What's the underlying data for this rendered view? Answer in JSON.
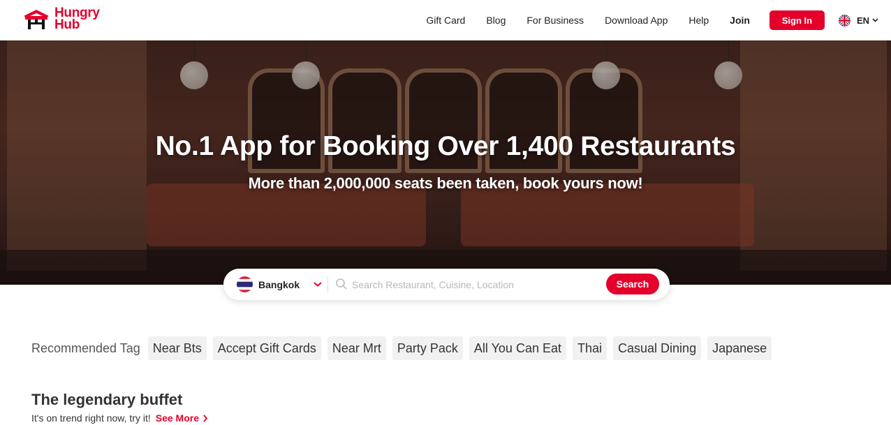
{
  "header": {
    "logo_line1": "Hungry",
    "logo_line2": "Hub",
    "nav": [
      "Gift Card",
      "Blog",
      "For Business",
      "Download App",
      "Help"
    ],
    "join": "Join",
    "sign_in": "Sign In",
    "language": "EN"
  },
  "hero": {
    "title": "No.1 App for Booking Over 1,400 Restaurants",
    "subtitle": "More than 2,000,000 seats been taken, book yours now!"
  },
  "search": {
    "city": "Bangkok",
    "placeholder": "Search Restaurant, Cuisine, Location",
    "button": "Search"
  },
  "recommended": {
    "label": "Recommended Tag",
    "tags": [
      "Near Bts",
      "Accept Gift Cards",
      "Near Mrt",
      "Party Pack",
      "All You Can Eat",
      "Thai",
      "Casual Dining",
      "Japanese"
    ]
  },
  "section": {
    "title": "The legendary buffet",
    "subtitle": "It's on trend right now, try it!",
    "see_more": "See More"
  },
  "colors": {
    "brand": "#e4002b"
  },
  "icons": [
    "hungry-hub-logo-icon",
    "uk-flag-icon",
    "chevron-down-icon",
    "thailand-flag-icon",
    "search-icon",
    "chevron-right-icon"
  ]
}
